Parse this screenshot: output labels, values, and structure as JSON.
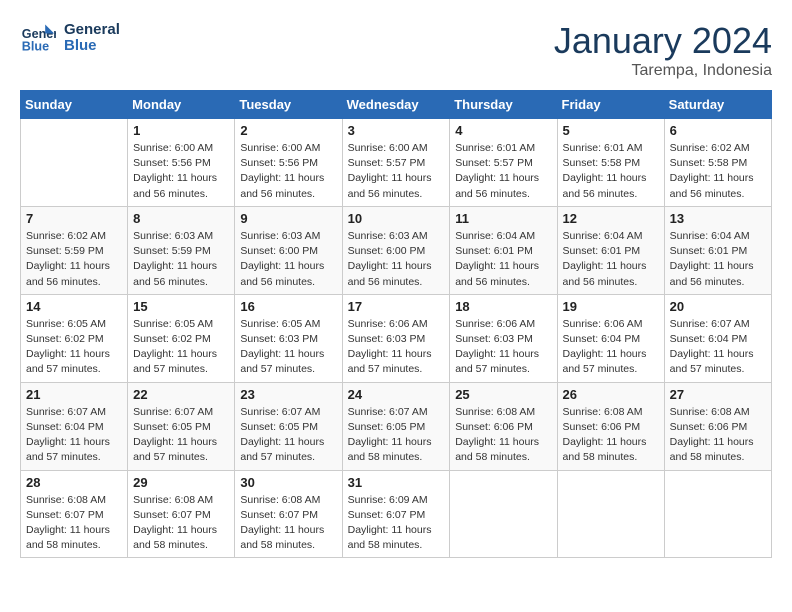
{
  "logo": {
    "line1": "General",
    "line2": "Blue"
  },
  "title": "January 2024",
  "subtitle": "Tarempa, Indonesia",
  "days_of_week": [
    "Sunday",
    "Monday",
    "Tuesday",
    "Wednesday",
    "Thursday",
    "Friday",
    "Saturday"
  ],
  "weeks": [
    [
      {
        "day": "",
        "info": ""
      },
      {
        "day": "1",
        "info": "Sunrise: 6:00 AM\nSunset: 5:56 PM\nDaylight: 11 hours\nand 56 minutes."
      },
      {
        "day": "2",
        "info": "Sunrise: 6:00 AM\nSunset: 5:56 PM\nDaylight: 11 hours\nand 56 minutes."
      },
      {
        "day": "3",
        "info": "Sunrise: 6:00 AM\nSunset: 5:57 PM\nDaylight: 11 hours\nand 56 minutes."
      },
      {
        "day": "4",
        "info": "Sunrise: 6:01 AM\nSunset: 5:57 PM\nDaylight: 11 hours\nand 56 minutes."
      },
      {
        "day": "5",
        "info": "Sunrise: 6:01 AM\nSunset: 5:58 PM\nDaylight: 11 hours\nand 56 minutes."
      },
      {
        "day": "6",
        "info": "Sunrise: 6:02 AM\nSunset: 5:58 PM\nDaylight: 11 hours\nand 56 minutes."
      }
    ],
    [
      {
        "day": "7",
        "info": "Sunrise: 6:02 AM\nSunset: 5:59 PM\nDaylight: 11 hours\nand 56 minutes."
      },
      {
        "day": "8",
        "info": "Sunrise: 6:03 AM\nSunset: 5:59 PM\nDaylight: 11 hours\nand 56 minutes."
      },
      {
        "day": "9",
        "info": "Sunrise: 6:03 AM\nSunset: 6:00 PM\nDaylight: 11 hours\nand 56 minutes."
      },
      {
        "day": "10",
        "info": "Sunrise: 6:03 AM\nSunset: 6:00 PM\nDaylight: 11 hours\nand 56 minutes."
      },
      {
        "day": "11",
        "info": "Sunrise: 6:04 AM\nSunset: 6:01 PM\nDaylight: 11 hours\nand 56 minutes."
      },
      {
        "day": "12",
        "info": "Sunrise: 6:04 AM\nSunset: 6:01 PM\nDaylight: 11 hours\nand 56 minutes."
      },
      {
        "day": "13",
        "info": "Sunrise: 6:04 AM\nSunset: 6:01 PM\nDaylight: 11 hours\nand 56 minutes."
      }
    ],
    [
      {
        "day": "14",
        "info": "Sunrise: 6:05 AM\nSunset: 6:02 PM\nDaylight: 11 hours\nand 57 minutes."
      },
      {
        "day": "15",
        "info": "Sunrise: 6:05 AM\nSunset: 6:02 PM\nDaylight: 11 hours\nand 57 minutes."
      },
      {
        "day": "16",
        "info": "Sunrise: 6:05 AM\nSunset: 6:03 PM\nDaylight: 11 hours\nand 57 minutes."
      },
      {
        "day": "17",
        "info": "Sunrise: 6:06 AM\nSunset: 6:03 PM\nDaylight: 11 hours\nand 57 minutes."
      },
      {
        "day": "18",
        "info": "Sunrise: 6:06 AM\nSunset: 6:03 PM\nDaylight: 11 hours\nand 57 minutes."
      },
      {
        "day": "19",
        "info": "Sunrise: 6:06 AM\nSunset: 6:04 PM\nDaylight: 11 hours\nand 57 minutes."
      },
      {
        "day": "20",
        "info": "Sunrise: 6:07 AM\nSunset: 6:04 PM\nDaylight: 11 hours\nand 57 minutes."
      }
    ],
    [
      {
        "day": "21",
        "info": "Sunrise: 6:07 AM\nSunset: 6:04 PM\nDaylight: 11 hours\nand 57 minutes."
      },
      {
        "day": "22",
        "info": "Sunrise: 6:07 AM\nSunset: 6:05 PM\nDaylight: 11 hours\nand 57 minutes."
      },
      {
        "day": "23",
        "info": "Sunrise: 6:07 AM\nSunset: 6:05 PM\nDaylight: 11 hours\nand 57 minutes."
      },
      {
        "day": "24",
        "info": "Sunrise: 6:07 AM\nSunset: 6:05 PM\nDaylight: 11 hours\nand 58 minutes."
      },
      {
        "day": "25",
        "info": "Sunrise: 6:08 AM\nSunset: 6:06 PM\nDaylight: 11 hours\nand 58 minutes."
      },
      {
        "day": "26",
        "info": "Sunrise: 6:08 AM\nSunset: 6:06 PM\nDaylight: 11 hours\nand 58 minutes."
      },
      {
        "day": "27",
        "info": "Sunrise: 6:08 AM\nSunset: 6:06 PM\nDaylight: 11 hours\nand 58 minutes."
      }
    ],
    [
      {
        "day": "28",
        "info": "Sunrise: 6:08 AM\nSunset: 6:07 PM\nDaylight: 11 hours\nand 58 minutes."
      },
      {
        "day": "29",
        "info": "Sunrise: 6:08 AM\nSunset: 6:07 PM\nDaylight: 11 hours\nand 58 minutes."
      },
      {
        "day": "30",
        "info": "Sunrise: 6:08 AM\nSunset: 6:07 PM\nDaylight: 11 hours\nand 58 minutes."
      },
      {
        "day": "31",
        "info": "Sunrise: 6:09 AM\nSunset: 6:07 PM\nDaylight: 11 hours\nand 58 minutes."
      },
      {
        "day": "",
        "info": ""
      },
      {
        "day": "",
        "info": ""
      },
      {
        "day": "",
        "info": ""
      }
    ]
  ]
}
